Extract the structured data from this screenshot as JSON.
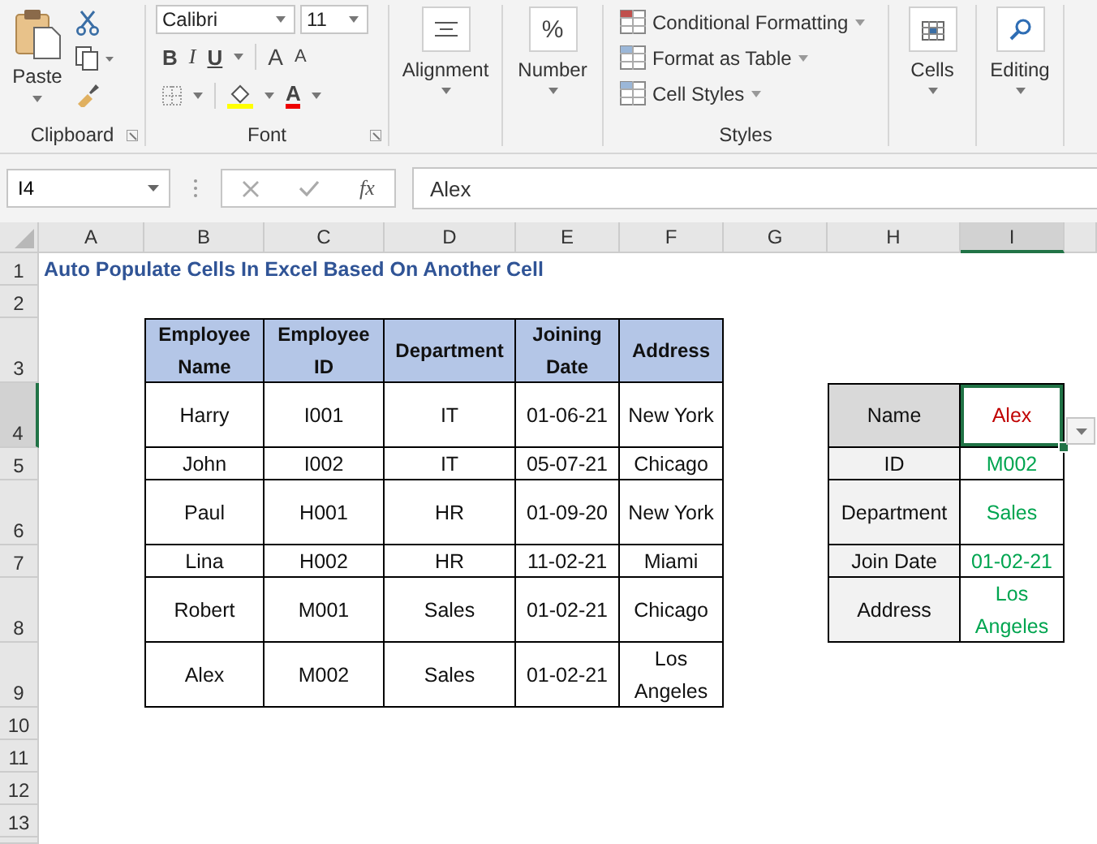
{
  "ribbon": {
    "clipboard": {
      "paste": "Paste",
      "label": "Clipboard"
    },
    "font": {
      "name": "Calibri",
      "size": "11",
      "bold": "B",
      "italic": "I",
      "underline": "U",
      "grow": "A",
      "shrink": "A",
      "font_color": "A",
      "label": "Font"
    },
    "alignment": {
      "label": "Alignment"
    },
    "number": {
      "glyph": "%",
      "label": "Number"
    },
    "styles": {
      "items": [
        "Conditional Formatting",
        "Format as Table",
        "Cell Styles"
      ],
      "label": "Styles"
    },
    "cells": {
      "label": "Cells"
    },
    "editing": {
      "label": "Editing"
    }
  },
  "formula_bar": {
    "name_box": "I4",
    "fx": "fx",
    "formula": "Alex"
  },
  "columns": [
    {
      "label": "A",
      "selected": false
    },
    {
      "label": "B",
      "selected": false
    },
    {
      "label": "C",
      "selected": false
    },
    {
      "label": "D",
      "selected": false
    },
    {
      "label": "E",
      "selected": false
    },
    {
      "label": "F",
      "selected": false
    },
    {
      "label": "G",
      "selected": false
    },
    {
      "label": "H",
      "selected": false
    },
    {
      "label": "I",
      "selected": true
    }
  ],
  "rows": [
    {
      "label": "1",
      "selected": false
    },
    {
      "label": "2",
      "selected": false
    },
    {
      "label": "3",
      "selected": false
    },
    {
      "label": "4",
      "selected": true
    },
    {
      "label": "5",
      "selected": false
    },
    {
      "label": "6",
      "selected": false
    },
    {
      "label": "7",
      "selected": false
    },
    {
      "label": "8",
      "selected": false
    },
    {
      "label": "9",
      "selected": false
    },
    {
      "label": "10",
      "selected": false
    },
    {
      "label": "11",
      "selected": false
    },
    {
      "label": "12",
      "selected": false
    },
    {
      "label": "13",
      "selected": false
    }
  ],
  "title": "Auto Populate Cells In Excel Based On Another Cell",
  "employee_table": {
    "columns": [
      "Employee Name",
      "Employee ID",
      "Department",
      "Joining Date",
      "Address"
    ],
    "rows": [
      [
        "Harry",
        "I001",
        "IT",
        "01-06-21",
        "New York"
      ],
      [
        "John",
        "I002",
        "IT",
        "05-07-21",
        "Chicago"
      ],
      [
        "Paul",
        "H001",
        "HR",
        "01-09-20",
        "New York"
      ],
      [
        "Lina",
        "H002",
        "HR",
        "11-02-21",
        "Miami"
      ],
      [
        "Robert",
        "M001",
        "Sales",
        "01-02-21",
        "Chicago"
      ],
      [
        "Alex",
        "M002",
        "Sales",
        "01-02-21",
        "Los Angeles"
      ]
    ]
  },
  "lookup": [
    {
      "kind": "dropdown",
      "label": "Name",
      "value": "Alex",
      "color": "#c00000",
      "selected": true
    },
    {
      "kind": "result",
      "label": "ID",
      "value": "M002",
      "color": "#00a550",
      "selected": false
    },
    {
      "kind": "result",
      "label": "Department",
      "value": "Sales",
      "color": "#00a550",
      "selected": false
    },
    {
      "kind": "result",
      "label": "Join Date",
      "value": "01-02-21",
      "color": "#00a550",
      "selected": false
    },
    {
      "kind": "result",
      "label": "Address",
      "value": "Los Angeles",
      "color": "#00a550",
      "selected": false
    }
  ]
}
